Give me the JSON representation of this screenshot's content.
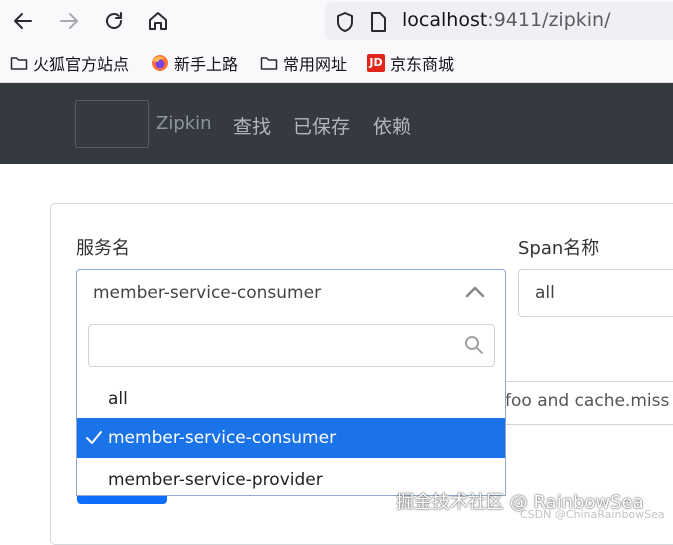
{
  "browser": {
    "url_host": "localhost",
    "url_rest": ":9411/zipkin/",
    "icons": [
      "back-arrow-icon",
      "forward-arrow-icon",
      "reload-icon",
      "home-icon",
      "shield-icon",
      "page-icon"
    ]
  },
  "bookmarks": [
    {
      "label": "火狐官方站点",
      "icon": "folder-icon"
    },
    {
      "label": "新手上路",
      "icon": "firefox-icon"
    },
    {
      "label": "常用网址",
      "icon": "folder-icon"
    },
    {
      "label": "京东商城",
      "icon": "jd-icon"
    }
  ],
  "jd_icon_text": "JD",
  "app": {
    "brand": "Zipkin",
    "nav": [
      "查找",
      "已保存",
      "依赖"
    ]
  },
  "form": {
    "service_label": "服务名",
    "service_value": "member-service-consumer",
    "span_label": "Span名称",
    "span_value": "all",
    "tags_text": "foo and cache.miss"
  },
  "dropdown": {
    "search_value": "",
    "options": [
      {
        "label": "all",
        "selected": false
      },
      {
        "label": "member-service-consumer",
        "selected": true
      },
      {
        "label": "member-service-provider",
        "selected": false
      }
    ]
  },
  "watermark": {
    "main": "掘金技术社区 @ RainbowSea",
    "sub": "CSDN @ChinaRainbowSea"
  },
  "colors": {
    "appbar": "#343a40",
    "selected": "#1a73e8",
    "primary_button": "#0d6efd"
  }
}
